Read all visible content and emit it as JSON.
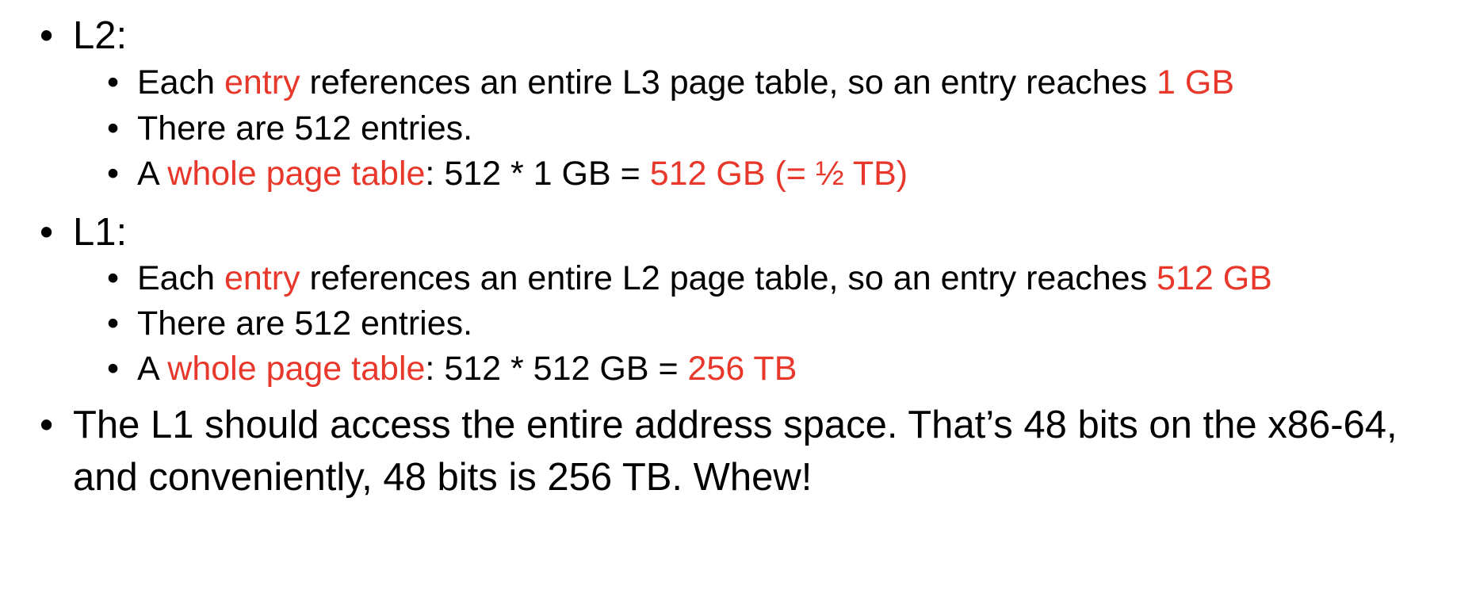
{
  "bullet": "•",
  "sections": [
    {
      "heading": "L2:",
      "items": [
        {
          "parts": [
            "Each ",
            "entry",
            " references an entire L3 page table, so an entry reaches ",
            "1 GB"
          ]
        },
        {
          "parts": [
            "There are 512 entries."
          ]
        },
        {
          "parts": [
            "A ",
            "whole page table",
            ": 512 * 1 GB = ",
            "512 GB (= ½ TB)"
          ]
        }
      ]
    },
    {
      "heading": "L1:",
      "items": [
        {
          "parts": [
            "Each ",
            "entry",
            " references an entire L2 page table, so an entry reaches ",
            "512 GB"
          ]
        },
        {
          "parts": [
            "There are 512 entries."
          ]
        },
        {
          "parts": [
            "A ",
            "whole page table",
            ": 512 * 512 GB = ",
            "256 TB"
          ]
        }
      ]
    }
  ],
  "closing": "The L1 should access the entire address space. That’s 48 bits on the x86-64, and conveniently, 48 bits is 256 TB. Whew!",
  "colors": {
    "text": "#000000",
    "highlight": "#e8372b"
  }
}
